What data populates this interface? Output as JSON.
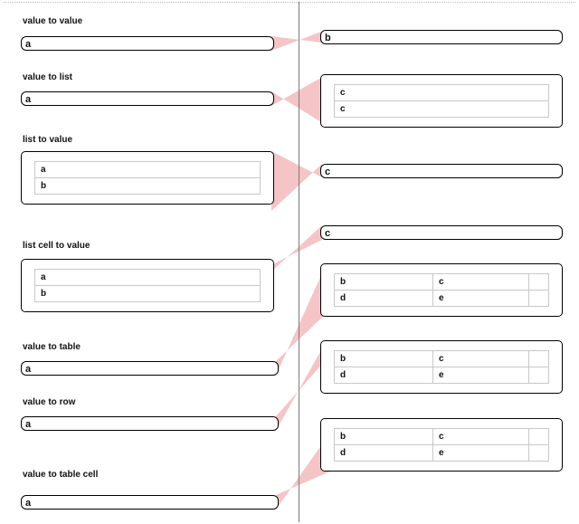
{
  "labels": {
    "vtov": "value to value",
    "vtol": "value to list",
    "ltov": "list to value",
    "lctov": "list cell to value",
    "vtot": "value to table",
    "vtor": "value to row",
    "vtotc": "value to table cell"
  },
  "vtov": {
    "left": "a",
    "right": "b"
  },
  "vtol": {
    "left": "a",
    "right_list": [
      "c",
      "c"
    ]
  },
  "ltov": {
    "left_list": [
      "a",
      "b"
    ],
    "right": "c"
  },
  "lctov": {
    "left_list": [
      "a",
      "b"
    ],
    "right": "c"
  },
  "vtot": {
    "left": "a",
    "right_rows": [
      {
        "c0": "b",
        "c1": "c",
        "c2": ""
      },
      {
        "c0": "d",
        "c1": "e",
        "c2": ""
      }
    ]
  },
  "vtor": {
    "left": "a",
    "right_rows": [
      {
        "c0": "b",
        "c1": "c",
        "c2": ""
      },
      {
        "c0": "d",
        "c1": "e",
        "c2": ""
      }
    ]
  },
  "vtotc": {
    "left": "a",
    "right_rows": [
      {
        "c0": "b",
        "c1": "c",
        "c2": ""
      },
      {
        "c0": "d",
        "c1": "e",
        "c2": ""
      }
    ]
  },
  "colors": {
    "wedge": "#f5c4c7"
  }
}
